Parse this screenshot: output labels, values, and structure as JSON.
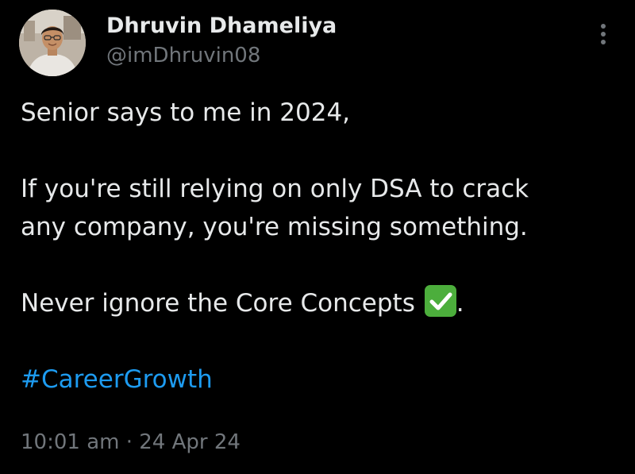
{
  "author": {
    "display_name": "Dhruvin Dhameliya",
    "handle": "@imDhruvin08"
  },
  "tweet": {
    "line1": "Senior says to me in 2024,",
    "line2": "If you're still relying on only DSA to crack",
    "line3": "any company, you're missing something.",
    "line4": "Never ignore the Core Concepts",
    "line4_end": ".",
    "check_icon": "white-heavy-check-mark-icon",
    "hashtag": "#CareerGrowth"
  },
  "meta": {
    "time": "10:01 am",
    "separator": "·",
    "date": "24 Apr 24"
  },
  "colors": {
    "background": "#000000",
    "text": "#e7e9ea",
    "secondary": "#71767b",
    "link": "#1d9bf0",
    "check": "#4cae3c"
  }
}
